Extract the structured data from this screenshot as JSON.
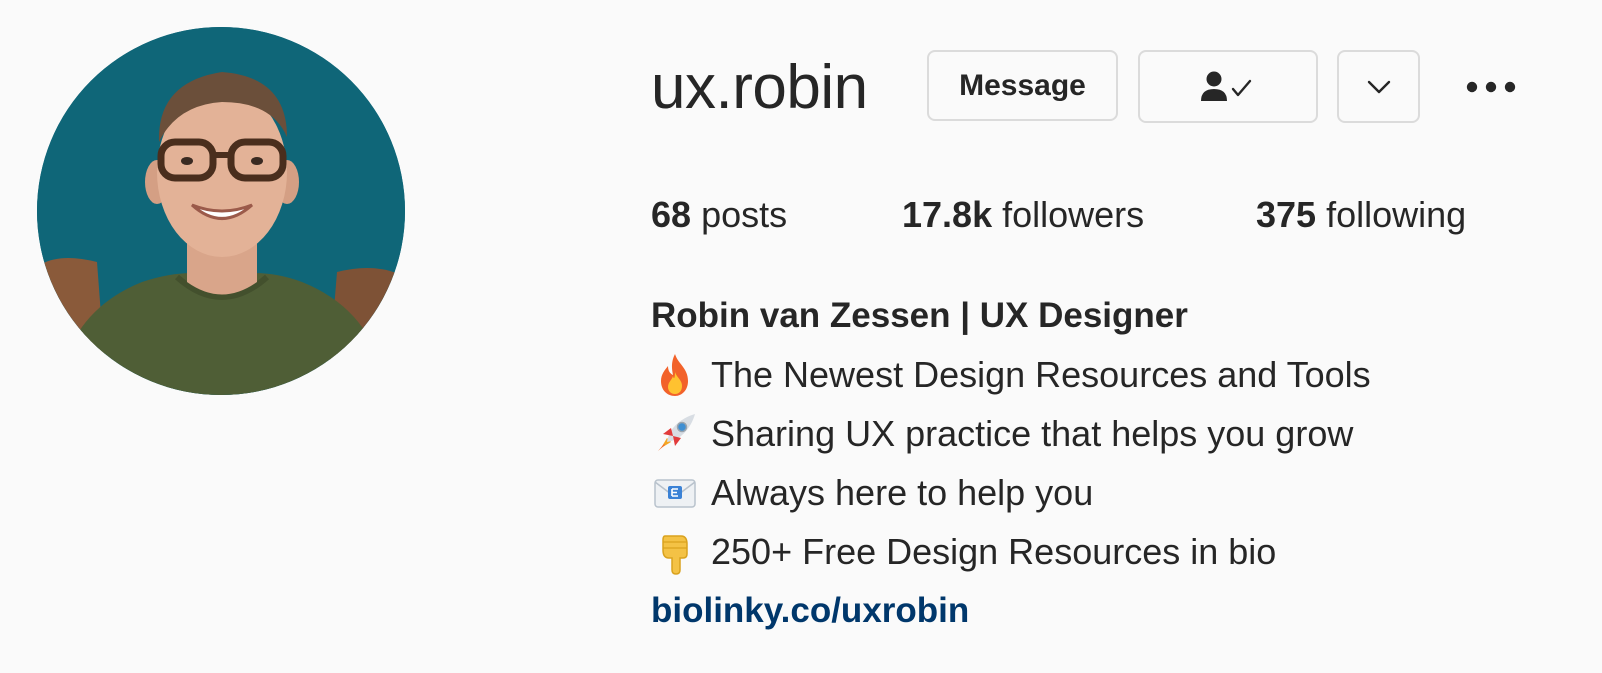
{
  "profile": {
    "username": "ux.robin",
    "avatar_icon": "profile-photo",
    "accent_background": "#0f6678"
  },
  "actions": {
    "message_label": "Message",
    "following_icon": "person-check-icon",
    "dropdown_icon": "chevron-down-icon",
    "more_icon": "more-horizontal-icon"
  },
  "stats": {
    "posts_count": "68",
    "posts_label": "posts",
    "followers_count": "17.8k",
    "followers_label": "followers",
    "following_count": "375",
    "following_label": "following"
  },
  "bio": {
    "full_name": "Robin van Zessen | UX Designer",
    "lines": [
      {
        "icon": "fire-emoji",
        "text": "The Newest Design Resources and Tools"
      },
      {
        "icon": "rocket-emoji",
        "text": "Sharing UX practice that helps you grow"
      },
      {
        "icon": "email-emoji",
        "text": "Always here to help you"
      },
      {
        "icon": "pointing-down-emoji",
        "text": "250+ Free Design Resources in bio"
      }
    ],
    "link": "biolinky.co/uxrobin",
    "link_color": "#00376b"
  }
}
